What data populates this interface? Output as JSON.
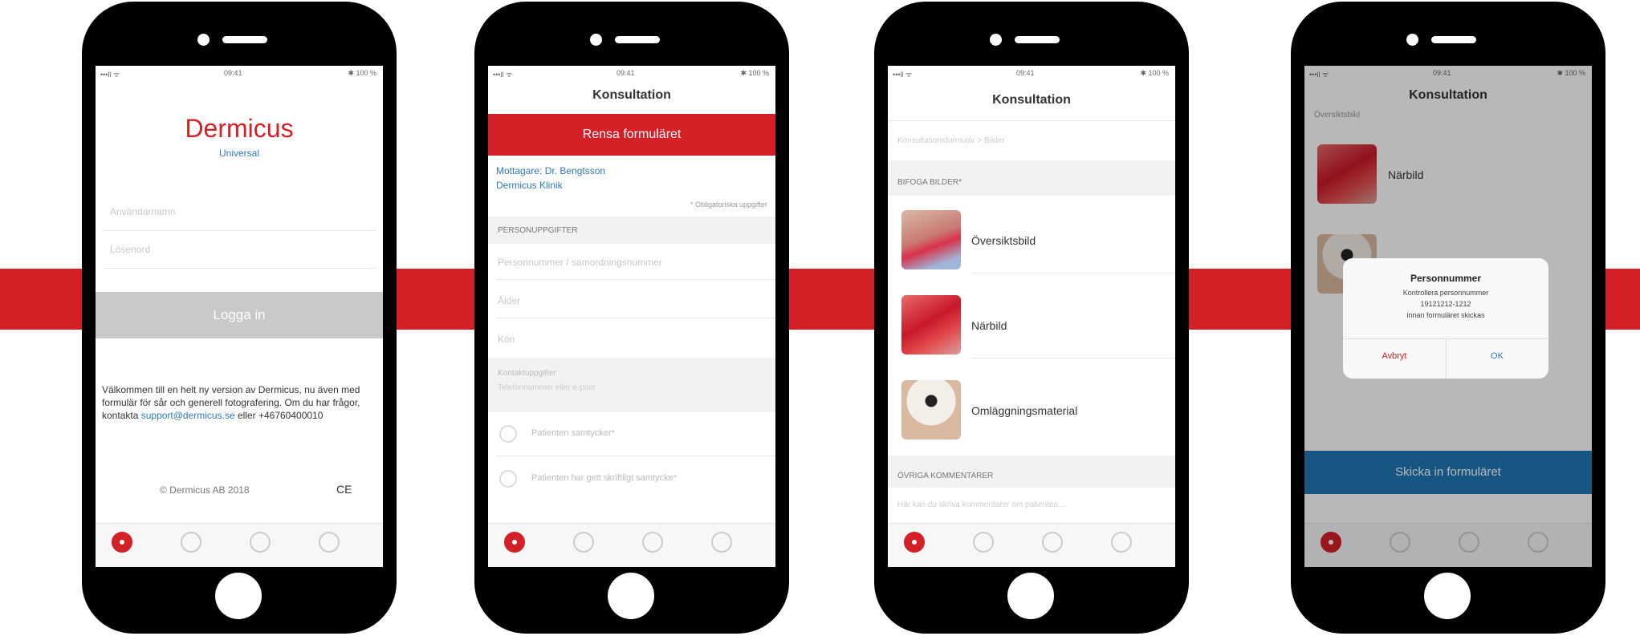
{
  "colors": {
    "brand_red": "#d42027",
    "link_blue": "#2d7bb8",
    "submit_blue": "#2077b4"
  },
  "status_bar": {
    "signal": "•••ll ᯤ",
    "time": "09:41",
    "battery": "✱ 100 %"
  },
  "screen1": {
    "brand": "Dermicus",
    "brand_sub": "Universal",
    "username_placeholder": "Användarnamn",
    "password_placeholder": "Lösenord",
    "login_button": "Logga in",
    "welcome_text": "Välkommen till en helt ny version av Dermicus, nu även med formulär för sår och generell fotografering. Om du har frågor, kontakta",
    "support_email": "support@dermicus.se",
    "support_suffix": "eller +46760400010",
    "copyright": "© Dermicus AB 2018",
    "ce_mark": "CE"
  },
  "screen2": {
    "nav_title": "Konsultation",
    "clear_button": "Rensa formuläret",
    "recipient_line1": "Mottagare: Dr. Bengtsson",
    "recipient_line2": "Dermicus Klinik",
    "required_note": "* Obligatoriska uppgifter",
    "section_personal": "PERSONUPPGIFTER",
    "field_personnummer": "Personnummer / samordningsnummer",
    "field_age": "Ålder",
    "field_gender": "Kön",
    "field_contact_label": "Kontaktuppgifter",
    "field_contact_placeholder": "Telefonnummer eller e-post",
    "checkbox1": "Patienten samtycker*",
    "checkbox2": "Patienten har gett skriftligt samtycke*"
  },
  "screen3": {
    "nav_title": "Konsultation",
    "breadcrumb": "Konsultationsformulär > Bilder",
    "section_images": "BIFOGA BILDER*",
    "image_items": [
      "Översiktsbild",
      "Närbild",
      "Omläggningsmaterial"
    ],
    "section_comments": "ÖVRIGA KOMMENTARER",
    "comment_placeholder": "Här kan du skriva kommentarer om patienten…"
  },
  "screen4": {
    "nav_title": "Konsultation",
    "section_label": "Översiktsbild",
    "image_label": "Närbild",
    "dialog_title": "Personnummer",
    "dialog_line1": "Kontrollera personnummer",
    "dialog_line2": "19121212-1212",
    "dialog_line3": "innan formuläret skickas",
    "dialog_cancel": "Avbryt",
    "dialog_ok": "OK",
    "submit_button": "Skicka in formuläret"
  }
}
